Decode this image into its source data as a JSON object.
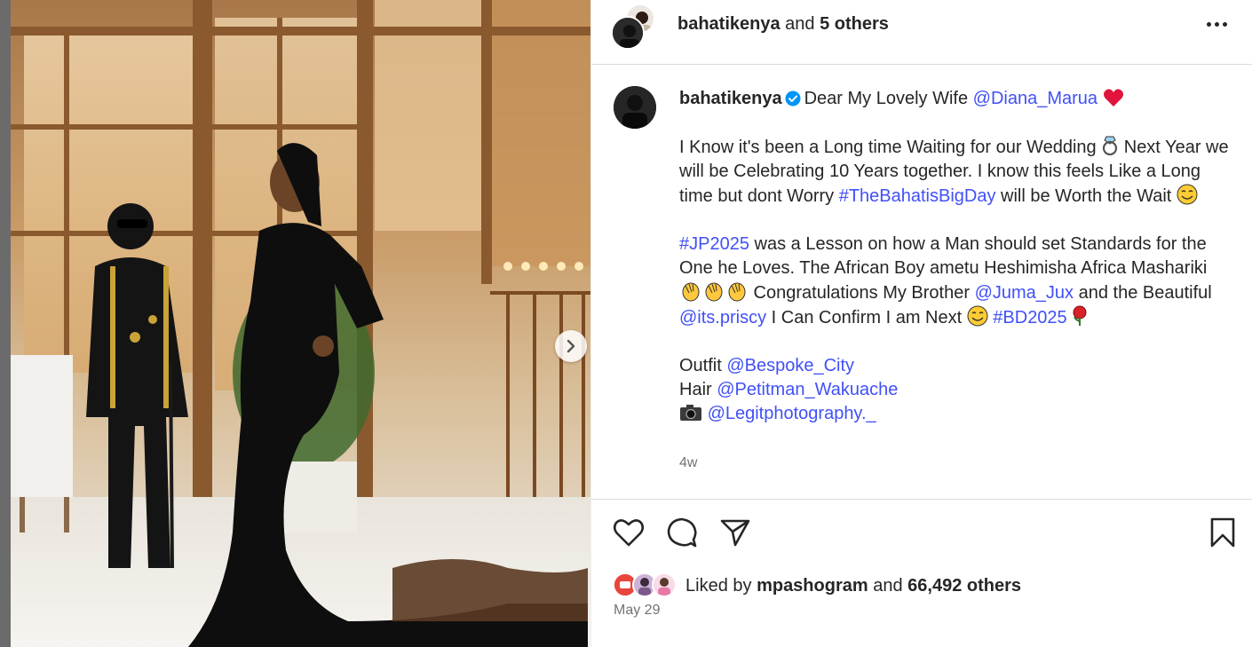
{
  "header": {
    "username": "bahatikenya",
    "connector": " and ",
    "others": "5 others"
  },
  "caption": {
    "username": "bahatikenya",
    "p1_text": "Dear My Lovely Wife ",
    "p1_mention": "@Diana_Marua",
    "p2_a": "I Know it's been a Long time Waiting for our Wedding ",
    "p2_b": " Next Year we will be Celebrating 10 Years together. I know this feels Like a Long time but dont Worry ",
    "p2_tag": "#TheBahatisBigDay",
    "p2_c": " will be Worth the Wait ",
    "p3_tag1": "#JP2025",
    "p3_a": " was a Lesson on how a Man should set Standards for the One he Loves. The African Boy ametu Heshimisha Africa Mashariki ",
    "p3_b": " Congratulations My Brother ",
    "p3_mention1": "@Juma_Jux",
    "p3_c": " and the Beautiful ",
    "p3_mention2": "@its.priscy",
    "p3_d": " I Can Confirm I am Next ",
    "p3_tag2": "#BD2025",
    "outfit_label": "Outfit ",
    "outfit_mention": "@Bespoke_City",
    "hair_label": "Hair ",
    "hair_mention": "@Petitman_Wakuache",
    "photo_mention": "@Legitphotography._",
    "age": "4w"
  },
  "likes": {
    "prefix": "Liked by ",
    "user": "mpashogram",
    "connector": " and ",
    "count": "66,492 others"
  },
  "date": "May 29",
  "icons": [
    "heart-icon",
    "comment-icon",
    "share-icon",
    "bookmark-icon",
    "more-icon",
    "verified-icon",
    "chevron-right-icon",
    "ring-emoji",
    "smile-emoji",
    "clap-emoji",
    "rose-emoji",
    "camera-emoji",
    "red-heart-emoji"
  ],
  "colors": {
    "link": "#4150f7",
    "verified": "#0095f6",
    "text": "#262626",
    "secondary": "#737373",
    "border": "#dbdbdb"
  }
}
